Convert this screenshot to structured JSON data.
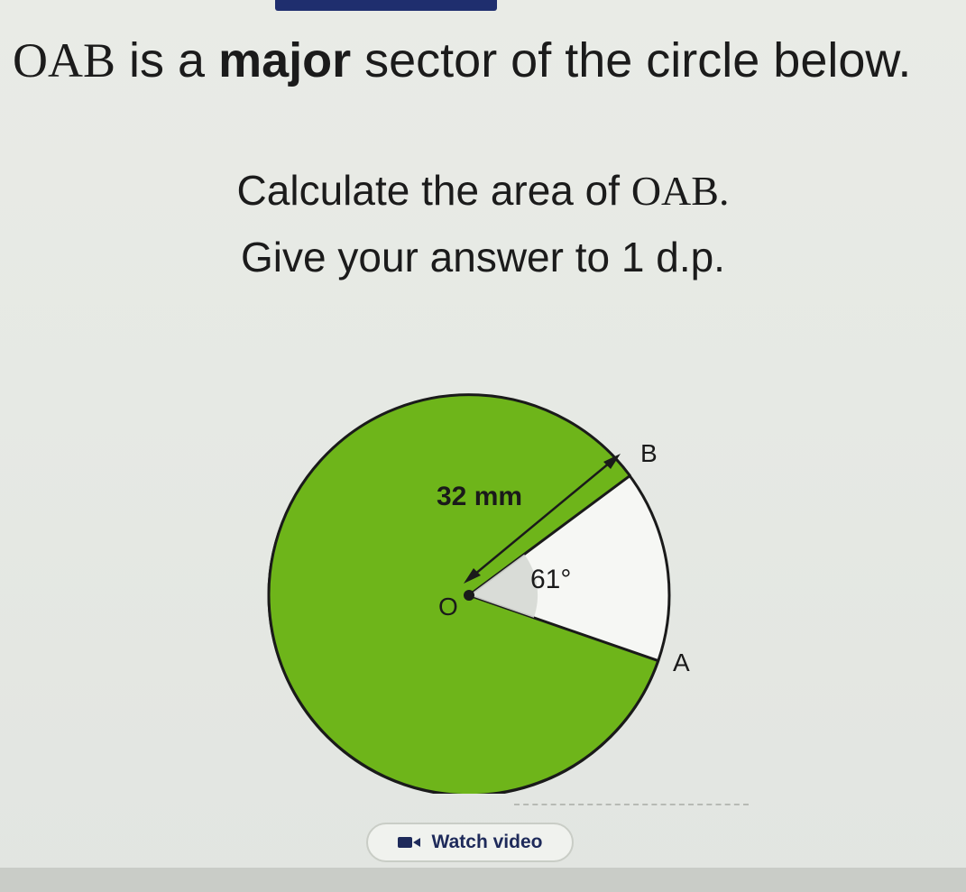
{
  "question": {
    "title_prefix": "OAB",
    "title_mid": " is a ",
    "title_bold": "major",
    "title_suffix": " sector of the circle below.",
    "line2_prefix": "Calculate the area of ",
    "line2_name": "OAB.",
    "line3": "Give your answer to 1 d.p."
  },
  "diagram": {
    "radius_label": "32 mm",
    "angle_label": "61°",
    "center_label": "O",
    "point_a_label": "A",
    "point_b_label": "B",
    "sector_color": "#6eb51a",
    "minor_shade_color": "#d6d8d4"
  },
  "watch_video": {
    "label": "Watch video",
    "icon": "video-icon"
  }
}
